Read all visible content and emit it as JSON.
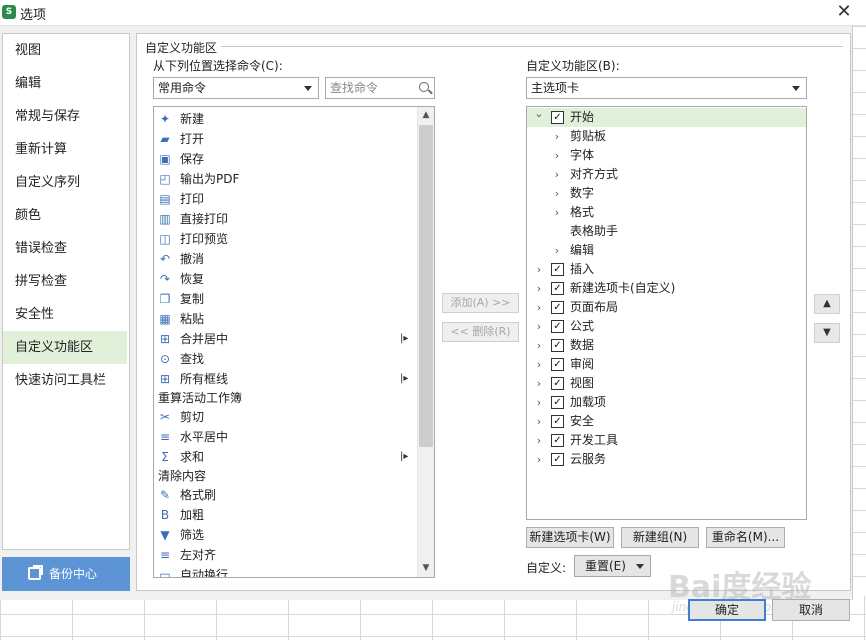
{
  "window": {
    "title": "选项",
    "app_icon": "S"
  },
  "sidebar": {
    "items": [
      {
        "label": "视图"
      },
      {
        "label": "编辑"
      },
      {
        "label": "常规与保存"
      },
      {
        "label": "重新计算"
      },
      {
        "label": "自定义序列"
      },
      {
        "label": "颜色"
      },
      {
        "label": "错误检查"
      },
      {
        "label": "拼写检查"
      },
      {
        "label": "安全性"
      },
      {
        "label": "自定义功能区",
        "selected": true
      },
      {
        "label": "快速访问工具栏"
      }
    ],
    "backup_label": "备份中心"
  },
  "main": {
    "group_title": "自定义功能区",
    "left": {
      "label": "从下列位置选择命令(C):",
      "select_value": "常用命令",
      "search_placeholder": "查找命令",
      "commands": [
        {
          "label": "新建",
          "icon": "new-doc-icon",
          "glyph": "✦"
        },
        {
          "label": "打开",
          "icon": "folder-icon",
          "glyph": "▰"
        },
        {
          "label": "保存",
          "icon": "save-icon",
          "glyph": "▣"
        },
        {
          "label": "输出为PDF",
          "icon": "pdf-icon",
          "glyph": "◰"
        },
        {
          "label": "打印",
          "icon": "printer-icon",
          "glyph": "▤"
        },
        {
          "label": "直接打印",
          "icon": "direct-print-icon",
          "glyph": "▥"
        },
        {
          "label": "打印预览",
          "icon": "print-preview-icon",
          "glyph": "◫"
        },
        {
          "label": "撤消",
          "icon": "undo-icon",
          "glyph": "↶"
        },
        {
          "label": "恢复",
          "icon": "redo-icon",
          "glyph": "↷"
        },
        {
          "label": "复制",
          "icon": "copy-icon",
          "glyph": "❐"
        },
        {
          "label": "粘贴",
          "icon": "paste-icon",
          "glyph": "▦"
        },
        {
          "label": "合并居中",
          "icon": "merge-center-icon",
          "glyph": "⊞",
          "submenu": true
        },
        {
          "label": "查找",
          "icon": "find-icon",
          "glyph": "⊙"
        },
        {
          "label": "所有框线",
          "icon": "borders-icon",
          "glyph": "⊞",
          "submenu": true
        },
        {
          "label": "重算活动工作簿",
          "icon": "",
          "glyph": ""
        },
        {
          "label": "剪切",
          "icon": "cut-icon",
          "glyph": "✂"
        },
        {
          "label": "水平居中",
          "icon": "align-center-icon",
          "glyph": "≡"
        },
        {
          "label": "求和",
          "icon": "sum-icon",
          "glyph": "Σ",
          "submenu": true
        },
        {
          "label": "清除内容",
          "icon": "",
          "glyph": ""
        },
        {
          "label": "格式刷",
          "icon": "format-painter-icon",
          "glyph": "✎"
        },
        {
          "label": "加粗",
          "icon": "bold-icon",
          "glyph": "B"
        },
        {
          "label": "筛选",
          "icon": "filter-icon",
          "glyph": "▼"
        },
        {
          "label": "左对齐",
          "icon": "align-left-icon",
          "glyph": "≡"
        },
        {
          "label": "自动换行",
          "icon": "wrap-text-icon",
          "glyph": "▭"
        }
      ]
    },
    "add_button": "添加(A) >>",
    "remove_button": "<< 删除(R)",
    "right": {
      "label": "自定义功能区(B):",
      "select_value": "主选项卡",
      "tree": [
        {
          "label": "开始",
          "level": 0,
          "expanded": true,
          "checked": true,
          "highlight": true
        },
        {
          "label": "剪贴板",
          "level": 1,
          "chevron": true
        },
        {
          "label": "字体",
          "level": 1,
          "chevron": true
        },
        {
          "label": "对齐方式",
          "level": 1,
          "chevron": true
        },
        {
          "label": "数字",
          "level": 1,
          "chevron": true
        },
        {
          "label": "格式",
          "level": 1,
          "chevron": true
        },
        {
          "label": "表格助手",
          "level": 1,
          "chevron": false
        },
        {
          "label": "编辑",
          "level": 1,
          "chevron": true
        },
        {
          "label": "插入",
          "level": 0,
          "checked": true
        },
        {
          "label": "新建选项卡(自定义)",
          "level": 0,
          "checked": true
        },
        {
          "label": "页面布局",
          "level": 0,
          "checked": true
        },
        {
          "label": "公式",
          "level": 0,
          "checked": true
        },
        {
          "label": "数据",
          "level": 0,
          "checked": true
        },
        {
          "label": "审阅",
          "level": 0,
          "checked": true
        },
        {
          "label": "视图",
          "level": 0,
          "checked": true
        },
        {
          "label": "加载项",
          "level": 0,
          "checked": true
        },
        {
          "label": "安全",
          "level": 0,
          "checked": true
        },
        {
          "label": "开发工具",
          "level": 0,
          "checked": true
        },
        {
          "label": "云服务",
          "level": 0,
          "checked": true
        }
      ],
      "new_tab_button": "新建选项卡(W)",
      "new_group_button": "新建组(N)",
      "rename_button": "重命名(M)...",
      "customize_label": "自定义:",
      "reset_value": "重置(E)"
    }
  },
  "footer": {
    "ok_label": "确定",
    "cancel_label": "取消"
  },
  "watermark": {
    "main": "Bai度经验",
    "sub": "jingyan.baidu.com"
  },
  "colors": {
    "selection_bg": "#e1f0d8",
    "backup_bg": "#5c94d6",
    "app_icon_bg": "#2e8b4e"
  }
}
